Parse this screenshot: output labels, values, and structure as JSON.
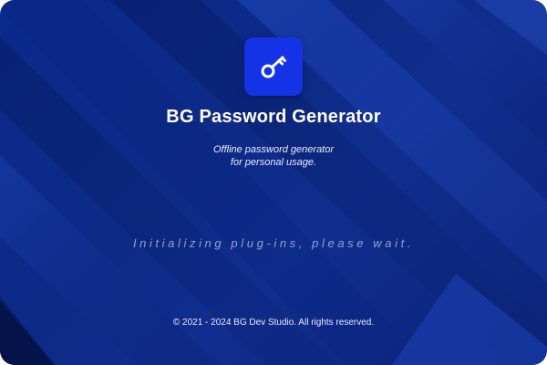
{
  "app": {
    "title": "BG Password Generator",
    "logo_icon": "key-icon",
    "tagline_line1": "Offline password generator",
    "tagline_line2": "for personal usage.",
    "status": "Initializing plug-ins, please wait.",
    "copyright": "© 2021 - 2024 BG Dev Studio. All rights reserved."
  },
  "colors": {
    "background": "#0d2a86",
    "logo_tile": "#1433e6",
    "text": "#ffffff"
  }
}
